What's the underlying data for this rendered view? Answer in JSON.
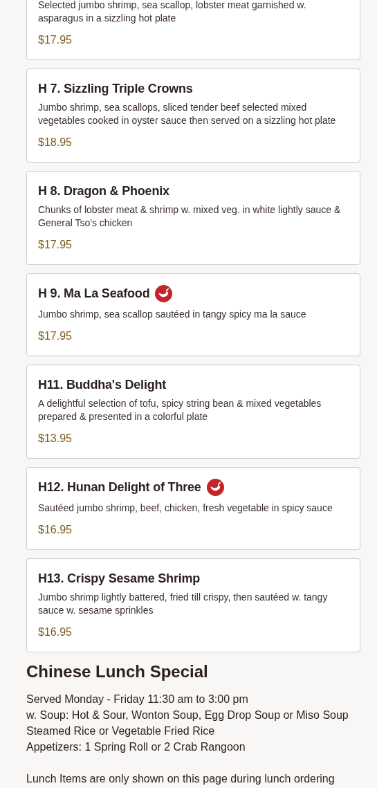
{
  "menu_items": [
    {
      "description": "Selected jumbo shrimp, sea scallop, lobster meat garnished w. asparagus in a sizzling hot plate",
      "price": "$17.95",
      "spicy": false
    },
    {
      "name": "H 7. Sizzling Triple Crowns",
      "description": "Jumbo shrimp, sea scallops, sliced tender beef selected mixed vegetables cooked in oyster sauce then served on a sizzling hot plate",
      "price": "$18.95",
      "spicy": false
    },
    {
      "name": "H 8. Dragon & Phoenix",
      "description": "Chunks of lobster meat & shrimp w. mixed veg. in white lightly sauce & General Tso's chicken",
      "price": "$17.95",
      "spicy": false
    },
    {
      "name": "H 9. Ma La Seafood",
      "description": "Jumbo shrimp, sea scallop sautéed in tangy spicy ma la sauce",
      "price": "$17.95",
      "spicy": true
    },
    {
      "name": "H11. Buddha's Delight",
      "description": "A delightful selection of tofu, spicy string bean & mixed vegetables prepared & presented in a colorful plate",
      "price": "$13.95",
      "spicy": false
    },
    {
      "name": "H12. Hunan Delight of Three",
      "description": "Sautéed jumbo shrimp, beef, chicken, fresh vegetable in spicy sauce",
      "price": "$16.95",
      "spicy": true
    },
    {
      "name": "H13. Crispy Sesame Shrimp",
      "description": "Jumbo shrimp lightly battered, fried till crispy, then sautéed w. tangy sauce w. sesame sprinkles",
      "price": "$16.95",
      "spicy": false
    }
  ],
  "section": {
    "title": "Chinese Lunch Special",
    "lines": [
      "Served Monday - Friday 11:30 am to 3:00 pm",
      "w. Soup: Hot & Sour, Wonton Soup, Egg Drop Soup or Miso Soup",
      "Steamed Rice or Vegetable Fried Rice",
      "Appetizers: 1 Spring Roll or 2 Crab Rangoon"
    ],
    "note": "Lunch Items are only shown on this page during lunch ordering"
  }
}
